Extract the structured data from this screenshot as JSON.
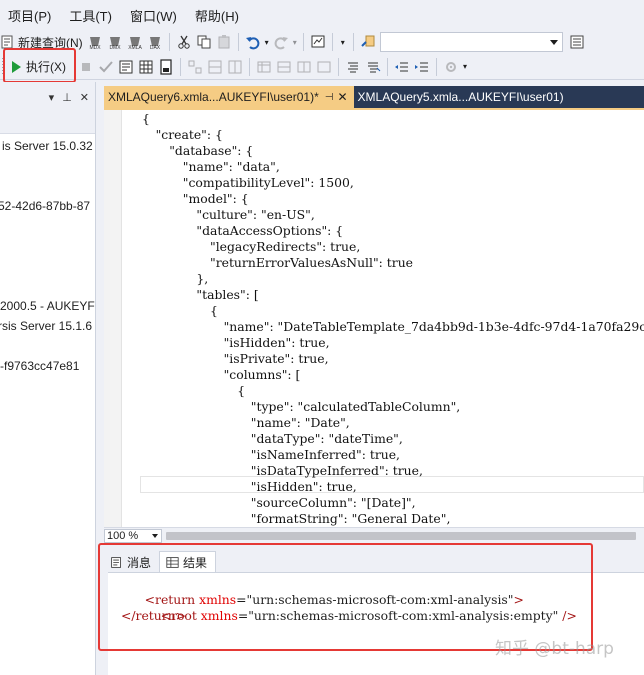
{
  "menu": {
    "items": [
      "项目(P)",
      "工具(T)",
      "窗口(W)",
      "帮助(H)"
    ]
  },
  "toolbar": {
    "new_query": "新建查询(N)",
    "execute": "执行(X)"
  },
  "left_panel": {
    "lines": [
      "is Server 15.0.32",
      "52-42d6-87bb-87",
      "2000.5 - AUKEYF",
      "rsis Server 15.1.6",
      "-f9763cc47e81"
    ]
  },
  "tabs": {
    "active": "XMLAQuery6.xmla...AUKEYFI\\user01)*",
    "inactive": "XMLAQuery5.xmla...AUKEYFI\\user01)"
  },
  "editor": {
    "code_lines": [
      "{",
      "\"create\": {",
      "\"database\": {",
      "\"name\": \"data\",",
      "\"compatibilityLevel\": 1500,",
      "\"model\": {",
      "\"culture\": \"en-US\",",
      "\"dataAccessOptions\": {",
      "\"legacyRedirects\": true,",
      "\"returnErrorValuesAsNull\": true",
      "},",
      "\"tables\": [",
      "{",
      "\"name\": \"DateTableTemplate_7da4bb9d-1b3e-4dfc-97d4-1a70fa29c",
      "\"isHidden\": true,",
      "\"isPrivate\": true,",
      "\"columns\": [",
      "{",
      "\"type\": \"calculatedTableColumn\",",
      "\"name\": \"Date\",",
      "\"dataType\": \"dateTime\",",
      "\"isNameInferred\": true,",
      "\"isDataTypeInferred\": true,",
      "\"isHidden\": true,",
      "\"sourceColumn\": \"[Date]\",",
      "\"formatString\": \"General Date\","
    ]
  },
  "zoom": "100 %",
  "results": {
    "tab_messages": "消息",
    "tab_results": "结果",
    "line1": {
      "tag_open": "<return ",
      "attr": "xmlns",
      "value": "=\"urn:schemas-microsoft-com:xml-analysis\"",
      "tag_close": ">"
    },
    "line2": {
      "tag_open": "<root ",
      "attr": "xmlns",
      "value": "=\"urn:schemas-microsoft-com:xml-analysis:empty\"",
      "tag_close": " />"
    },
    "line3": "</return>"
  },
  "watermark": "知乎 @bt-harp",
  "colors": {
    "tab_strip": "#293955",
    "active_tab": "#f5cc84",
    "highlight_box": "#e53935",
    "execute_icon": "#1f9b3a"
  }
}
